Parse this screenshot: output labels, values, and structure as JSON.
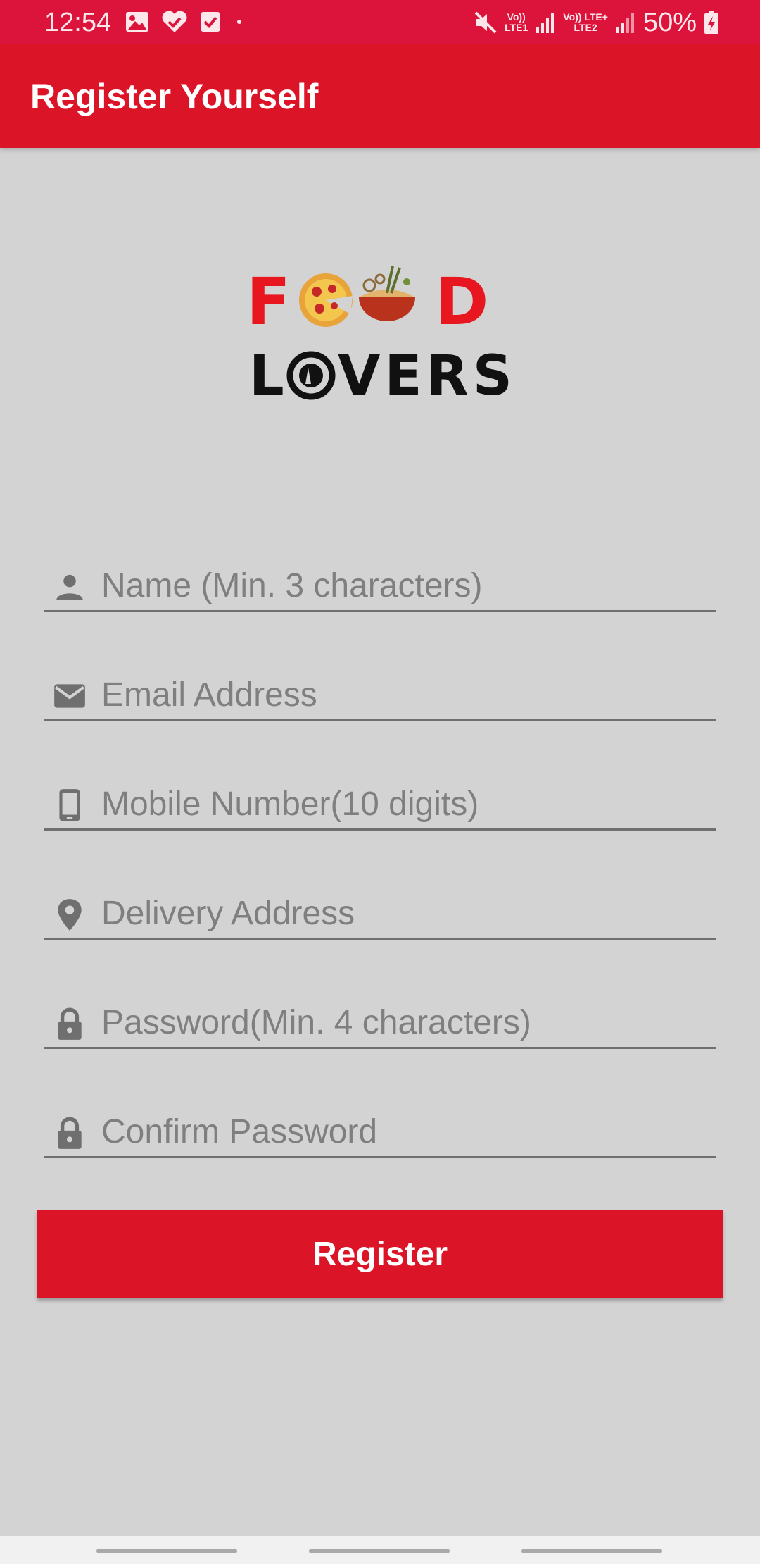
{
  "status_bar": {
    "time": "12:54",
    "battery": "50%",
    "net1_top": "Vo))",
    "net1_bottom": "LTE1",
    "net2_top": "Vo)) LTE+",
    "net2_bottom": "LTE2",
    "icons": [
      "image-icon",
      "heart-check-icon",
      "checkbox-icon",
      "dot-icon",
      "mute-icon",
      "signal-icon",
      "signal-icon",
      "battery-charging-icon"
    ]
  },
  "app_bar": {
    "title": "Register Yourself"
  },
  "logo": {
    "line1": "FOOD",
    "line2": "LOVERS",
    "colors": {
      "food": "#e8161f",
      "lovers": "#111111"
    }
  },
  "form": {
    "name": {
      "placeholder": "Name (Min. 3 characters)",
      "value": "",
      "icon": "person-icon"
    },
    "email": {
      "placeholder": "Email Address",
      "value": "",
      "icon": "mail-icon"
    },
    "mobile": {
      "placeholder": "Mobile Number(10 digits)",
      "value": "",
      "icon": "phone-icon"
    },
    "address": {
      "placeholder": "Delivery Address",
      "value": "",
      "icon": "location-pin-icon"
    },
    "password": {
      "placeholder": "Password(Min. 4 characters)",
      "value": "",
      "icon": "lock-icon"
    },
    "confirm_password": {
      "placeholder": "Confirm Password",
      "value": "",
      "icon": "lock-icon"
    }
  },
  "register_button": {
    "label": "Register"
  },
  "colors": {
    "primary": "#dc1428",
    "background": "#d3d3d3",
    "icon": "#6f6f6f"
  }
}
